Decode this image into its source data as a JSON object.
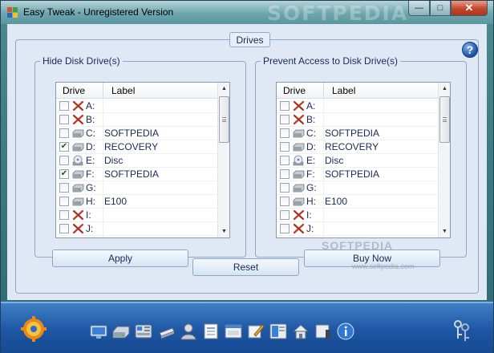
{
  "window": {
    "title": "Easy Tweak - Unregistered Version",
    "watermark": "SOFTPEDIA",
    "controls": {
      "minimize": "—",
      "maximize": "□",
      "close": "✕"
    }
  },
  "drives_section": {
    "legend": "Drives",
    "help": "?"
  },
  "hide_group": {
    "title": "Hide Disk Drive(s)",
    "columns": [
      "Drive",
      "Label"
    ],
    "rows": [
      {
        "checked": false,
        "icon": "disabled-x-icon",
        "letter": "A:",
        "label": ""
      },
      {
        "checked": false,
        "icon": "disabled-x-icon",
        "letter": "B:",
        "label": ""
      },
      {
        "checked": false,
        "icon": "hard-drive-icon",
        "letter": "C:",
        "label": "SOFTPEDIA"
      },
      {
        "checked": true,
        "icon": "hard-drive-icon",
        "letter": "D:",
        "label": "RECOVERY"
      },
      {
        "checked": false,
        "icon": "cd-drive-icon",
        "letter": "E:",
        "label": "Disc"
      },
      {
        "checked": true,
        "icon": "hard-drive-icon",
        "letter": "F:",
        "label": "SOFTPEDIA"
      },
      {
        "checked": false,
        "icon": "hard-drive-icon",
        "letter": "G:",
        "label": ""
      },
      {
        "checked": false,
        "icon": "hard-drive-icon",
        "letter": "H:",
        "label": "E100"
      },
      {
        "checked": false,
        "icon": "disabled-x-icon",
        "letter": "I:",
        "label": ""
      },
      {
        "checked": false,
        "icon": "disabled-x-icon",
        "letter": "J:",
        "label": ""
      }
    ]
  },
  "prevent_group": {
    "title": "Prevent Access to Disk Drive(s)",
    "columns": [
      "Drive",
      "Label"
    ],
    "rows": [
      {
        "checked": false,
        "icon": "disabled-x-icon",
        "letter": "A:",
        "label": ""
      },
      {
        "checked": false,
        "icon": "disabled-x-icon",
        "letter": "B:",
        "label": ""
      },
      {
        "checked": false,
        "icon": "hard-drive-icon",
        "letter": "C:",
        "label": "SOFTPEDIA"
      },
      {
        "checked": false,
        "icon": "hard-drive-icon",
        "letter": "D:",
        "label": "RECOVERY"
      },
      {
        "checked": false,
        "icon": "cd-drive-icon",
        "letter": "E:",
        "label": "Disc"
      },
      {
        "checked": false,
        "icon": "hard-drive-icon",
        "letter": "F:",
        "label": "SOFTPEDIA"
      },
      {
        "checked": false,
        "icon": "hard-drive-icon",
        "letter": "G:",
        "label": ""
      },
      {
        "checked": false,
        "icon": "hard-drive-icon",
        "letter": "H:",
        "label": "E100"
      },
      {
        "checked": false,
        "icon": "disabled-x-icon",
        "letter": "I:",
        "label": ""
      },
      {
        "checked": false,
        "icon": "disabled-x-icon",
        "letter": "J:",
        "label": ""
      }
    ]
  },
  "buttons": {
    "apply": "Apply",
    "reset": "Reset",
    "buy_now": "Buy Now"
  },
  "watermarks": {
    "middle": "SOFTPEDIA",
    "url": "www.softpedia.com"
  },
  "toolbar": {
    "icons": [
      "desktop-icon",
      "drive-icon",
      "network-icon",
      "printer-icon",
      "user-icon",
      "document-icon",
      "window-icon",
      "edit-icon",
      "startmenu-icon",
      "house-icon",
      "security-icon",
      "info-icon"
    ]
  },
  "colors": {
    "titlebar": "#6da6ae",
    "toolbar": "#1e56a3",
    "panel": "#dfe8f4",
    "text": "#1a2a55"
  }
}
